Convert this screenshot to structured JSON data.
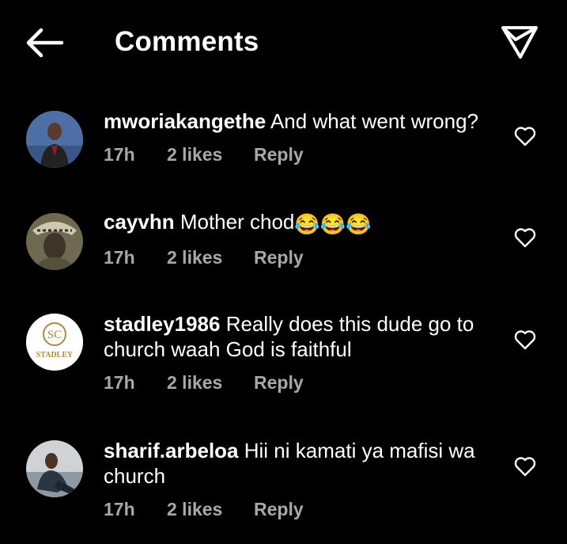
{
  "header": {
    "title": "Comments",
    "back_icon": "arrow-left-icon",
    "send_icon": "paper-plane-icon"
  },
  "comments": [
    {
      "username": "mworiakangethe",
      "text": "And what went wrong?",
      "time": "17h",
      "likes": "2 likes",
      "reply": "Reply",
      "avatar_icon": "profile-photo"
    },
    {
      "username": "cayvhn",
      "text": "Mother chod",
      "emoji": "😂😂😂",
      "time": "17h",
      "likes": "2 likes",
      "reply": "Reply",
      "avatar_icon": "profile-photo"
    },
    {
      "username": "stadley1986",
      "text": "Really does this dude go to church waah God is faithful",
      "time": "17h",
      "likes": "2 likes",
      "reply": "Reply",
      "avatar_logo_text": "STADLEY",
      "avatar_logo_initials": "SC"
    },
    {
      "username": "sharif.arbeloa",
      "text": "Hii ni kamati ya mafisi wa church",
      "time": "17h",
      "likes": "2 likes",
      "reply": "Reply",
      "avatar_icon": "profile-photo"
    }
  ],
  "colors": {
    "background": "#000000",
    "text": "#ffffff",
    "meta": "#a8a8a8"
  }
}
